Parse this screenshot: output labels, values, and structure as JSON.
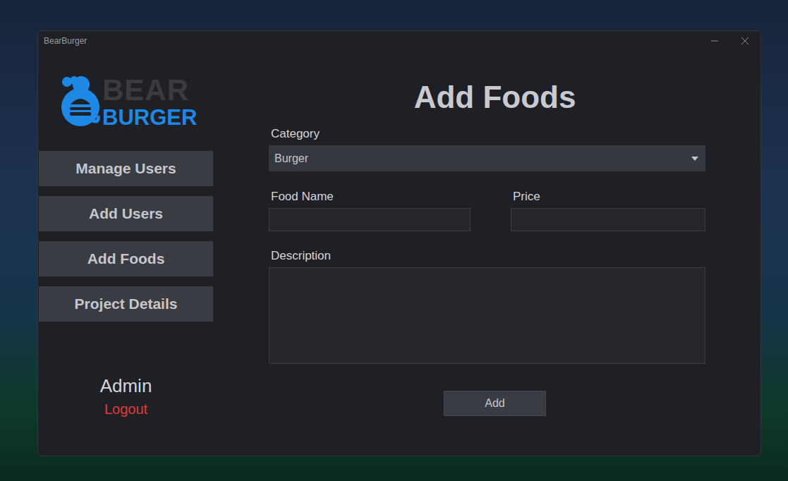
{
  "window": {
    "title": "BearBurger"
  },
  "logo": {
    "top": "BEAR",
    "bottom": "BURGER"
  },
  "sidebar": {
    "items": [
      {
        "label": "Manage Users",
        "selected": false
      },
      {
        "label": "Add Users",
        "selected": false
      },
      {
        "label": "Add Foods",
        "selected": false
      },
      {
        "label": "Project Details",
        "selected": false
      }
    ]
  },
  "user": {
    "name": "Admin",
    "logout": "Logout"
  },
  "form": {
    "title": "Add Foods",
    "category": {
      "label": "Category",
      "value": "Burger"
    },
    "food_name": {
      "label": "Food Name",
      "value": ""
    },
    "price": {
      "label": "Price",
      "value": ""
    },
    "description": {
      "label": "Description",
      "value": ""
    },
    "submit": "Add"
  }
}
